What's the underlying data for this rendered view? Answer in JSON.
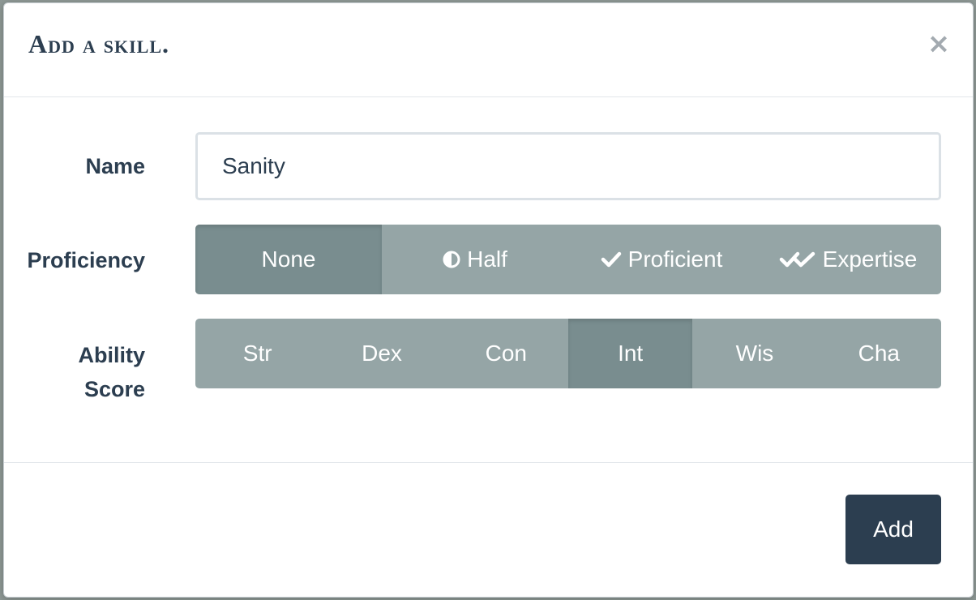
{
  "modal": {
    "title": "Add a skill.",
    "close_label": "×"
  },
  "form": {
    "name_label": "Name",
    "name_value": "Sanity",
    "proficiency_label": "Proficiency",
    "proficiency_options": [
      {
        "label": "None",
        "icon": "",
        "active": true
      },
      {
        "label": "Half",
        "icon": "half-circle-icon",
        "active": false
      },
      {
        "label": "Proficient",
        "icon": "check-icon",
        "active": false
      },
      {
        "label": "Expertise",
        "icon": "double-check-icon",
        "active": false
      }
    ],
    "ability_label": "Ability Score",
    "ability_options": [
      {
        "label": "Str",
        "active": false
      },
      {
        "label": "Dex",
        "active": false
      },
      {
        "label": "Con",
        "active": false
      },
      {
        "label": "Int",
        "active": true
      },
      {
        "label": "Wis",
        "active": false
      },
      {
        "label": "Cha",
        "active": false
      }
    ]
  },
  "footer": {
    "add_label": "Add"
  },
  "colors": {
    "primary": "#2c3e50",
    "segment_bg": "#95a5a6",
    "segment_active": "#798d8f"
  }
}
